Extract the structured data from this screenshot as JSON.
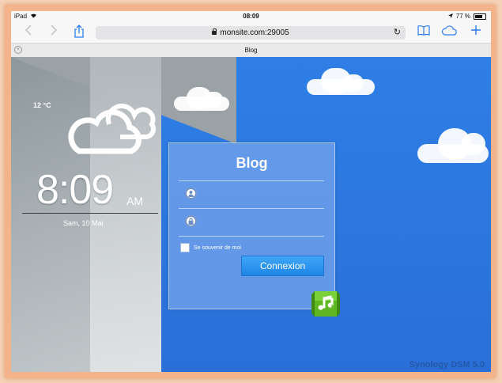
{
  "status_bar": {
    "device": "iPad",
    "time": "08:09",
    "battery": "77 %"
  },
  "toolbar": {
    "url": "monsite.com:29005"
  },
  "tab": {
    "title": "Blog"
  },
  "widget": {
    "temperature": "12 °C",
    "time": "8:09",
    "ampm": "AM",
    "date": "Sam, 10 Mai"
  },
  "login": {
    "title": "Blog",
    "username_placeholder": "",
    "password_placeholder": "",
    "remember_label": "Se souvenir de moi",
    "submit_label": "Connexion"
  },
  "footer": {
    "brand": "Synology DSM 5.0"
  },
  "colors": {
    "sky": "#2c79e0",
    "accent": "#2b7cf0",
    "button": "#1f86e6",
    "music_green": "#5fb821"
  }
}
